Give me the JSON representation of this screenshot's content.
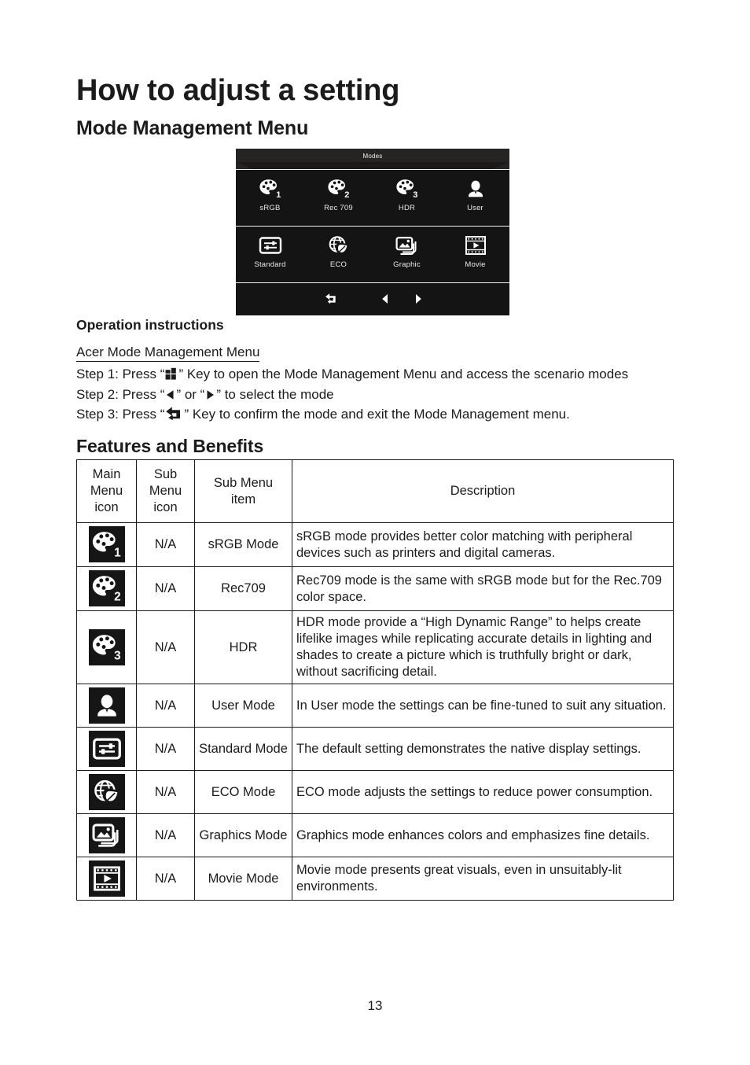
{
  "document": {
    "h1_title": "How to adjust a setting",
    "h2_mode_menu": "Mode Management Menu",
    "h2_features": "Features and Benefits",
    "page_number": "13"
  },
  "osd": {
    "title": "Modes",
    "row1": [
      {
        "icon": "palette-1-icon",
        "label": "sRGB"
      },
      {
        "icon": "palette-2-icon",
        "label": "Rec 709"
      },
      {
        "icon": "palette-3-icon",
        "label": "HDR"
      },
      {
        "icon": "user-icon",
        "label": "User"
      }
    ],
    "row2": [
      {
        "icon": "sliders-icon",
        "label": "Standard"
      },
      {
        "icon": "eco-globe-leaf-icon",
        "label": "ECO"
      },
      {
        "icon": "graphic-images-icon",
        "label": "Graphic"
      },
      {
        "icon": "movie-filmstrip-icon",
        "label": "Movie"
      }
    ],
    "footer_icons": [
      "return-arrow-icon",
      "left-arrow-icon",
      "right-arrow-icon"
    ]
  },
  "operation": {
    "title": "Operation instructions",
    "subtitle": "Acer Mode Management Menu",
    "step1_a": "Step 1: Press “",
    "step1_b": "” Key to open the Mode Management Menu and access the scenario modes",
    "step2_a": "Step 2: Press “",
    "step2_b": "” or “",
    "step2_c": "” to select the mode",
    "step3_a": "Step 3: Press “",
    "step3_b": "” Key to confirm the mode and exit the Mode Management menu."
  },
  "table": {
    "headers": {
      "main_menu_icon": "Main\nMenu\nicon",
      "main_menu_icon_l1": "Main",
      "main_menu_icon_l2": "Menu",
      "main_menu_icon_l3": "icon",
      "sub_menu_icon_l1": "Sub",
      "sub_menu_icon_l2": "Menu",
      "sub_menu_icon_l3": "icon",
      "sub_menu_item_l1": "Sub Menu",
      "sub_menu_item_l2": "item",
      "description": "Description"
    },
    "rows": [
      {
        "icon": "palette-1-icon",
        "sub_menu_icon": "N/A",
        "sub_menu_item": "sRGB Mode",
        "description": "sRGB mode provides better color matching with peripheral devices such as printers and digital cameras."
      },
      {
        "icon": "palette-2-icon",
        "sub_menu_icon": "N/A",
        "sub_menu_item": "Rec709",
        "description": "Rec709 mode is the same with sRGB mode but for the Rec.709 color space."
      },
      {
        "icon": "palette-3-icon",
        "sub_menu_icon": "N/A",
        "sub_menu_item": "HDR",
        "description": "HDR mode provide a “High Dynamic Range” to helps create lifelike images while replicating accurate details in lighting and shades to create a picture which is truthfully bright or dark, without sacrificing detail."
      },
      {
        "icon": "user-icon",
        "sub_menu_icon": "N/A",
        "sub_menu_item": "User Mode",
        "description": "In User mode the settings can be fine-tuned to suit any situation."
      },
      {
        "icon": "sliders-icon",
        "sub_menu_icon": "N/A",
        "sub_menu_item": "Standard Mode",
        "description": "The default setting demonstrates the native display settings."
      },
      {
        "icon": "eco-globe-leaf-icon",
        "sub_menu_icon": "N/A",
        "sub_menu_item": "ECO Mode",
        "description": "ECO mode adjusts the settings to reduce power consumption."
      },
      {
        "icon": "graphic-images-icon",
        "sub_menu_icon": "N/A",
        "sub_menu_item": "Graphics Mode",
        "description": "Graphics mode enhances colors and emphasizes fine details."
      },
      {
        "icon": "movie-filmstrip-icon",
        "sub_menu_icon": "N/A",
        "sub_menu_item": "Movie Mode",
        "description": "Movie mode presents great visuals, even in unsuitably-lit environments."
      }
    ]
  },
  "colors": {
    "text": "#1b1b1b",
    "osd_background": "#141414",
    "osd_header": "#262323",
    "osd_text": "#f1f1f1",
    "icon_tile": "#161616",
    "icon_glyph": "#ffffff",
    "table_border": "#1b1b1b"
  }
}
